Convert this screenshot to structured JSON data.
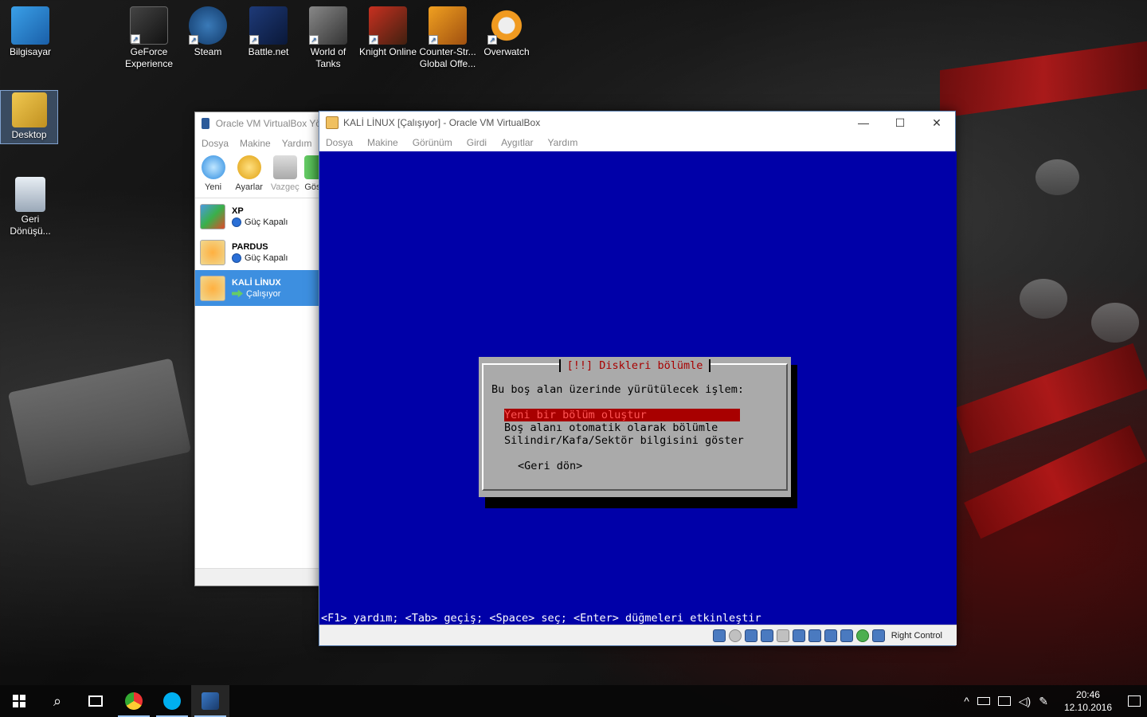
{
  "desktop": {
    "icons": [
      {
        "label": "Bilgisayar"
      },
      {
        "label": "GeForce Experience"
      },
      {
        "label": "Steam"
      },
      {
        "label": "Battle.net"
      },
      {
        "label": "World of Tanks"
      },
      {
        "label": "Knight Online"
      },
      {
        "label": "Counter-Str... Global Offe..."
      },
      {
        "label": "Overwatch"
      },
      {
        "label": "Desktop"
      },
      {
        "label": "Geri Dönüşü..."
      }
    ]
  },
  "manager": {
    "title": "Oracle VM VirtualBox Yö",
    "menu": [
      "Dosya",
      "Makine",
      "Yardım"
    ],
    "toolbar": [
      "Yeni",
      "Ayarlar",
      "Vazgeç",
      "Gös"
    ],
    "vms": [
      {
        "name": "XP",
        "state": "Güç Kapalı"
      },
      {
        "name": "PARDUS",
        "state": "Güç Kapalı"
      },
      {
        "name": "KALİ LİNUX",
        "state": "Çalışıyor"
      }
    ]
  },
  "vmwindow": {
    "title": "KALİ LİNUX [Çalışıyor] - Oracle VM VirtualBox",
    "menu": [
      "Dosya",
      "Makine",
      "Görünüm",
      "Girdi",
      "Aygıtlar",
      "Yardım"
    ],
    "controls": {
      "minimize": "—",
      "maximize": "☐",
      "close": "✕"
    },
    "dialog": {
      "title": "[!!] Diskleri bölümle",
      "prompt": "Bu boş alan üzerinde yürütülecek işlem:",
      "options": [
        "Yeni bir bölüm oluştur",
        "Boş alanı otomatik olarak bölümle",
        "Silindir/Kafa/Sektör bilgisini göster"
      ],
      "back": "<Geri dön>"
    },
    "helpbar": "<F1> yardım; <Tab> geçiş; <Space> seç; <Enter> düğmeleri etkinleştir",
    "hostkey": "Right Control"
  },
  "taskbar": {
    "time": "20:46",
    "date": "12.10.2016"
  }
}
